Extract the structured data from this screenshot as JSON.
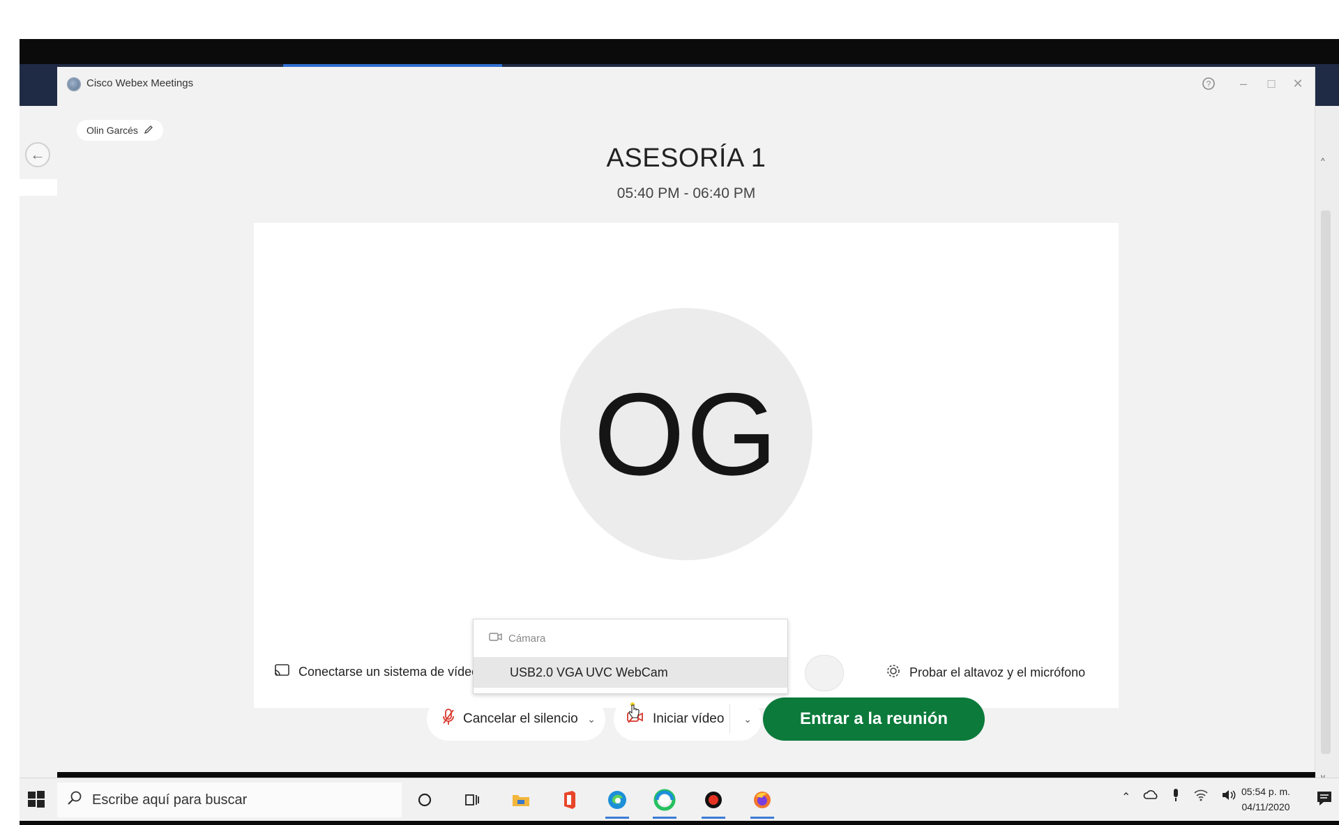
{
  "window": {
    "app_title": "Cisco Webex Meetings"
  },
  "header": {
    "user_name": "Olin Garcés",
    "meeting_title": "ASESORÍA 1",
    "meeting_time": "05:40 PM - 06:40 PM"
  },
  "preview": {
    "avatar_initials": "OG",
    "connect_video_label": "Conectarse un sistema de vídeo",
    "test_audio_label": "Probar el altavoz y el micrófono"
  },
  "camera_menu": {
    "header": "Cámara",
    "option": "USB2.0 VGA UVC WebCam"
  },
  "controls": {
    "mute_label": "Cancelar el silencio",
    "video_label": "Iniciar vídeo",
    "join_label": "Entrar a la reunión"
  },
  "taskbar": {
    "search_placeholder": "Escribe aquí para buscar",
    "time": "05:54 p. m.",
    "date": "04/11/2020"
  },
  "colors": {
    "join_green": "#0b7a3b",
    "mute_red": "#d9362b",
    "taskbar_accent": "#3b7bd6"
  }
}
